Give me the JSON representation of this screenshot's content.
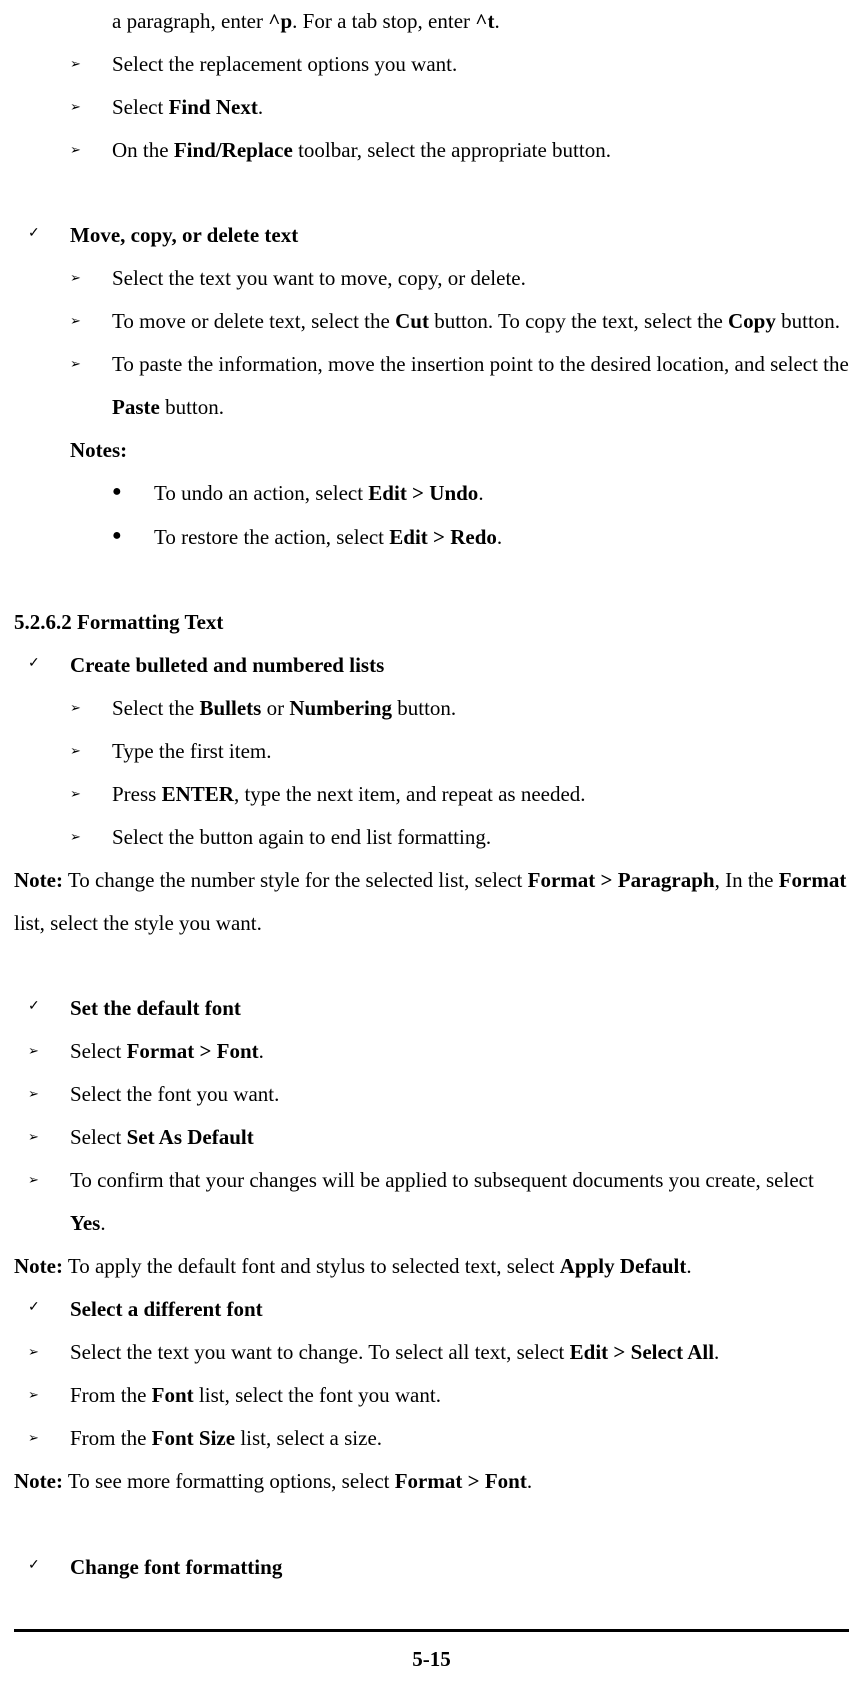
{
  "topFragment": {
    "pre": "a paragraph, enter ",
    "b1": "^p",
    "mid": ". For a tab stop, enter ",
    "b2": "^t",
    "post": "."
  },
  "s1": {
    "i1": "Select the replacement options you want.",
    "i2": {
      "pre": "Select ",
      "b": "Find Next",
      "post": "."
    },
    "i3": {
      "pre": "On the ",
      "b": "Find/Replace",
      "post": " toolbar, select the appropriate button."
    }
  },
  "moveHeading": "Move, copy, or delete text",
  "move": {
    "i1": "Select the text you want to move, copy, or delete.",
    "i2": {
      "pre": "To move or delete text, select the ",
      "b1": "Cut",
      "mid": " button. To copy the text, select the ",
      "b2": "Copy",
      "post": " button."
    },
    "i3": {
      "pre": "To paste the information, move the insertion point to the desired location, and select the ",
      "b": "Paste",
      "post": " button."
    }
  },
  "notesLabel": "Notes:",
  "notes": {
    "n1": {
      "pre": "To undo an action, select ",
      "b": "Edit > Undo",
      "post": "."
    },
    "n2": {
      "pre": "To restore the action, select ",
      "b": "Edit > Redo",
      "post": "."
    }
  },
  "fmtHeading": "5.2.6.2 Formatting Text",
  "bulHeading": "Create bulleted and numbered lists",
  "bul": {
    "i1": {
      "pre": "Select the ",
      "b1": "Bullets",
      "mid": " or ",
      "b2": "Numbering",
      "post": " button."
    },
    "i2": "Type the first item.",
    "i3": {
      "pre": "Press ",
      "b": "ENTER",
      "post": ", type the next item, and repeat as needed."
    },
    "i4": "Select the button again to end list formatting."
  },
  "bulNote": {
    "label": "Note:",
    "t1": " To change the number style for the selected list, select ",
    "b1": "Format > Paragraph",
    "t2": ", In the ",
    "b2": "Format",
    "t3": " list, select the style you want."
  },
  "defHeading": "Set the default font",
  "def": {
    "i1": {
      "pre": "Select ",
      "b": "Format > Font",
      "post": "."
    },
    "i2": "Select the font you want.",
    "i3": {
      "pre": "Select ",
      "b": "Set As Default"
    },
    "i4": {
      "pre": "To confirm that your changes will be applied to subsequent documents you create, select ",
      "b": "Yes",
      "post": "."
    }
  },
  "defNote": {
    "label": "Note:",
    "t1": " To apply the default font and stylus to selected text, select ",
    "b": "Apply Default",
    "post": "."
  },
  "diffHeading": "Select a different font",
  "diff": {
    "i1": {
      "pre": "Select the text you want to change. To select all text, select ",
      "b": "Edit > Select All",
      "post": "."
    },
    "i2": {
      "pre": "From the ",
      "b": "Font",
      "post": " list, select the font you want."
    },
    "i3": {
      "pre": "From the ",
      "b": "Font Size",
      "post": " list, select a size."
    }
  },
  "diffNote": {
    "label": "Note:",
    "t1": " To see more formatting options, select ",
    "b": "Format > Font",
    "post": "."
  },
  "changeHeading": "Change font formatting",
  "pageNum": "5-15"
}
